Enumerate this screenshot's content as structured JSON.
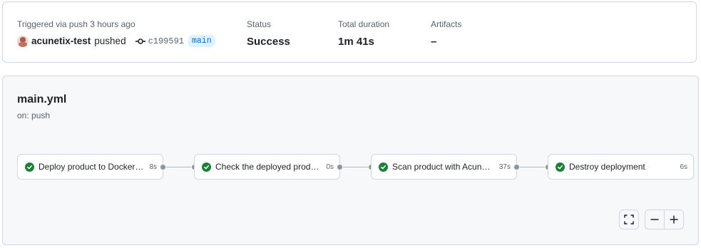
{
  "summary": {
    "trigger_text": "Triggered via push 3 hours ago",
    "actor": "acunetix-test",
    "action": "pushed",
    "commit": "c199591",
    "branch": "main",
    "status_label": "Status",
    "status_value": "Success",
    "duration_label": "Total duration",
    "duration_value": "1m 41s",
    "artifacts_label": "Artifacts",
    "artifacts_value": "–"
  },
  "workflow": {
    "file": "main.yml",
    "trigger": "on: push"
  },
  "jobs": [
    {
      "name": "Deploy product to Docker H...",
      "duration": "8s",
      "status": "success"
    },
    {
      "name": "Check the deployed product...",
      "duration": "0s",
      "status": "success"
    },
    {
      "name": "Scan product with Acunetix",
      "duration": "37s",
      "status": "success"
    },
    {
      "name": "Destroy deployment",
      "duration": "6s",
      "status": "success"
    }
  ],
  "controls": {
    "fullscreen_icon": "fullscreen-icon",
    "zoom_out_icon": "zoom-out-icon",
    "zoom_in_icon": "zoom-in-icon"
  },
  "colors": {
    "success": "#1a7f37",
    "branch_text": "#0969da",
    "branch_bg": "#ddf4ff"
  }
}
